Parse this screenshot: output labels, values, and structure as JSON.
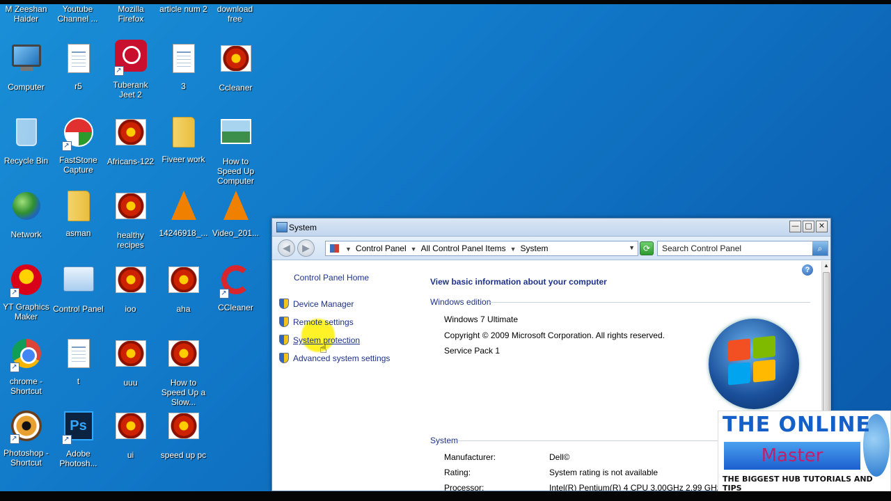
{
  "desktop": {
    "top_labels": [
      "M Zeeshan Haider",
      "Youtube Channel ...",
      "Mozilla Firefox",
      "article num 2",
      "download free"
    ],
    "icons": [
      {
        "label": "Computer",
        "icon": "computer-icon"
      },
      {
        "label": "r5",
        "icon": "document-icon"
      },
      {
        "label": "Tuberank Jeet 2",
        "icon": "tuberank-icon"
      },
      {
        "label": "3",
        "icon": "document-icon"
      },
      {
        "label": "Ccleaner",
        "icon": "image-icon"
      },
      {
        "label": "Recycle Bin",
        "icon": "recycle-bin-icon"
      },
      {
        "label": "FastStone Capture",
        "icon": "faststone-icon"
      },
      {
        "label": "Africans-122",
        "icon": "image-icon"
      },
      {
        "label": "Fiveer work",
        "icon": "folder-icon"
      },
      {
        "label": "How to Speed Up Computer",
        "icon": "picture-icon"
      },
      {
        "label": "Network",
        "icon": "network-icon"
      },
      {
        "label": "asman",
        "icon": "folder-icon"
      },
      {
        "label": "healthy recipes",
        "icon": "image-icon"
      },
      {
        "label": "14246918_...",
        "icon": "vlc-icon"
      },
      {
        "label": "Video_201...",
        "icon": "vlc-icon"
      },
      {
        "label": "YT Graphics Maker",
        "icon": "yt-graphics-icon"
      },
      {
        "label": "Control Panel",
        "icon": "control-panel-icon"
      },
      {
        "label": "ioo",
        "icon": "image-icon"
      },
      {
        "label": "aha",
        "icon": "image-icon"
      },
      {
        "label": "CCleaner",
        "icon": "ccleaner-icon"
      },
      {
        "label": "chrome - Shortcut",
        "icon": "chrome-icon"
      },
      {
        "label": "t",
        "icon": "document-icon"
      },
      {
        "label": "uuu",
        "icon": "image-icon"
      },
      {
        "label": "How to Speed Up a Slow...",
        "icon": "image-icon"
      },
      {
        "label": "Photoshop - Shortcut",
        "icon": "photoshop-shortcut-icon"
      },
      {
        "label": "Adobe Photosh...",
        "icon": "photoshop-icon"
      },
      {
        "label": "ui",
        "icon": "image-icon"
      },
      {
        "label": "speed up pc",
        "icon": "image-icon"
      }
    ]
  },
  "window": {
    "title": "System",
    "controls": {
      "minimize": "—",
      "maximize": "□",
      "close": "✕"
    },
    "breadcrumb": [
      "Control Panel",
      "All Control Panel Items",
      "System"
    ],
    "search_placeholder": "Search Control Panel",
    "left_pane": {
      "home": "Control Panel Home",
      "tasks": [
        "Device Manager",
        "Remote settings",
        "System protection",
        "Advanced system settings"
      ]
    },
    "main": {
      "heading": "View basic information about your computer",
      "windows_edition": {
        "section": "Windows edition",
        "edition": "Windows 7 Ultimate",
        "copyright": "Copyright © 2009 Microsoft Corporation.  All rights reserved.",
        "service_pack": "Service Pack 1"
      },
      "system": {
        "section": "System",
        "rows": [
          {
            "label": "Manufacturer:",
            "value": "Dell©"
          },
          {
            "label": "Rating:",
            "value": "System rating is not available"
          },
          {
            "label": "Processor:",
            "value": "Intel(R) Pentium(R) 4 CPU 3.00GHz   2.99 GHz"
          }
        ]
      }
    }
  },
  "watermark": {
    "line1": "THE ONLINE",
    "line2": "Master",
    "line3": "THE BIGGEST HUB TUTORIALS AND TIPS"
  },
  "colors": {
    "link": "#1e3287",
    "desktop": "#1178c8"
  }
}
